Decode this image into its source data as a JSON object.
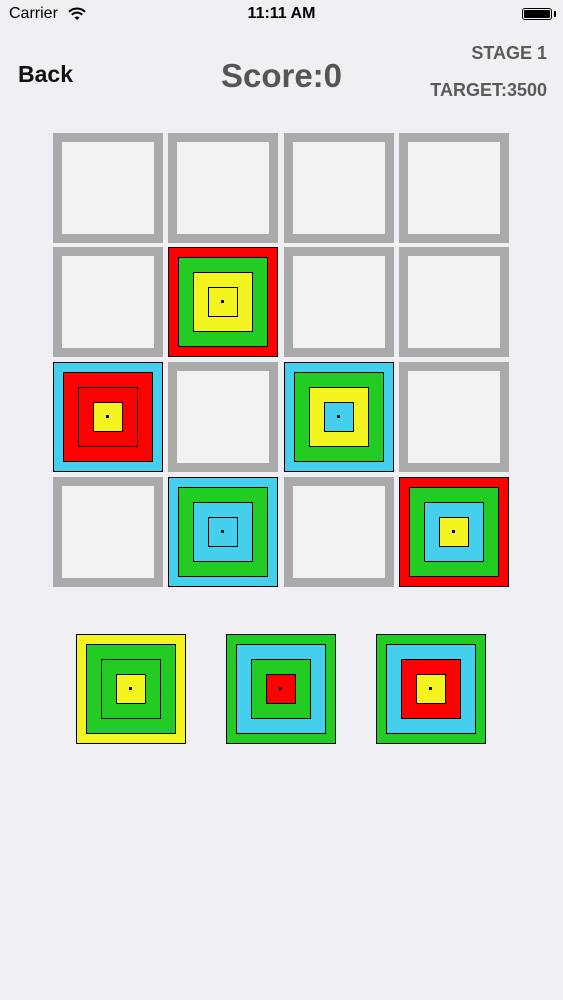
{
  "status_bar": {
    "carrier": "Carrier",
    "time": "11:11 AM"
  },
  "header": {
    "back_label": "Back",
    "score_label": "Score:0",
    "stage_label": "STAGE 1",
    "target_label": "TARGET:3500"
  },
  "colors": {
    "red": "#ff0000",
    "green": "#22cc22",
    "yellow": "#f4f420",
    "cyan": "#44d0ec",
    "empty_border": "#aaaaaa"
  },
  "board": {
    "rows": 4,
    "cols": 4,
    "cells": [
      [
        null,
        null,
        null,
        null
      ],
      [
        null,
        [
          "red",
          "green",
          "yellow",
          "yellow"
        ],
        null,
        null
      ],
      [
        [
          "cyan",
          "red",
          "red",
          "yellow"
        ],
        null,
        [
          "cyan",
          "green",
          "yellow",
          "cyan"
        ],
        null
      ],
      [
        null,
        [
          "cyan",
          "green",
          "cyan",
          "cyan"
        ],
        null,
        [
          "red",
          "green",
          "cyan",
          "yellow"
        ]
      ]
    ]
  },
  "tray": {
    "pieces": [
      [
        "yellow",
        "green",
        "green",
        "yellow"
      ],
      [
        "green",
        "cyan",
        "green",
        "red"
      ],
      [
        "green",
        "cyan",
        "red",
        "yellow"
      ]
    ]
  }
}
